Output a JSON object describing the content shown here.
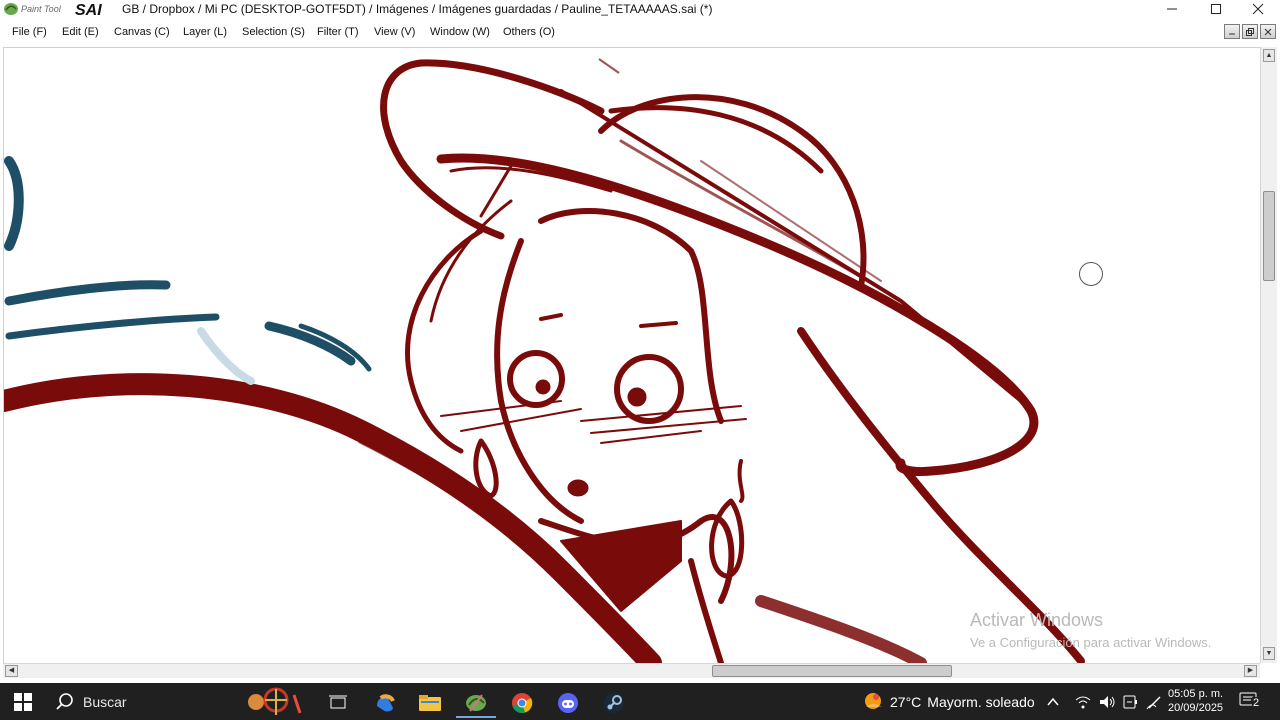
{
  "window": {
    "logo_text_small": "Paint Tool",
    "logo_text_big": "SAI",
    "title": "GB / Dropbox / Mi PC (DESKTOP-GOTF5DT) / Imágenes / Imágenes guardadas / Pauline_TETAAAAAS.sai (*)"
  },
  "menu": [
    {
      "label": "File (F)"
    },
    {
      "label": "Edit (E)"
    },
    {
      "label": "Canvas (C)"
    },
    {
      "label": "Layer (L)"
    },
    {
      "label": "Selection (S)"
    },
    {
      "label": "Filter (T)"
    },
    {
      "label": "View (V)"
    },
    {
      "label": "Window (W)"
    },
    {
      "label": "Others (O)"
    }
  ],
  "watermark": {
    "line1": "Activar Windows",
    "line2": "Ve a Configuración para activar Windows."
  },
  "taskbar": {
    "search_label": "Buscar",
    "weather_temp": "27°C",
    "weather_desc": "Mayorm. soleado",
    "time": "05:05 p. m.",
    "date": "20/09/2025",
    "notification_count": "2",
    "pinned": [
      "task-view",
      "copilot",
      "file-explorer",
      "painttool-sai",
      "chrome",
      "discord",
      "steam"
    ]
  },
  "colors": {
    "ink_red": "#7a0b0b",
    "ink_teal": "#1e4f66",
    "taskbar_bg": "#202020"
  }
}
